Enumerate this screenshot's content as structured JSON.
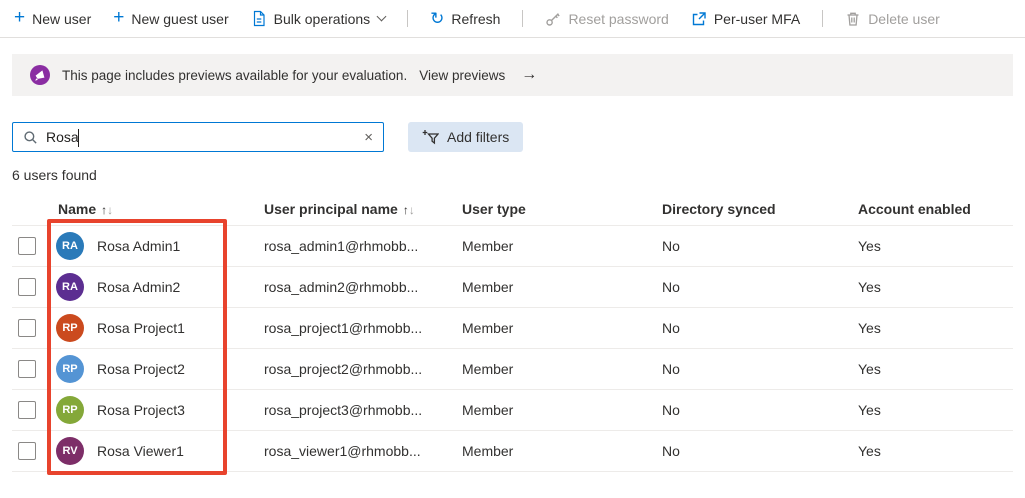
{
  "colors": {
    "accent": "#0078d4",
    "disabled_text": "#a19f9d",
    "highlight_red": "#e8432d",
    "banner_icon_purple": "#8a2da2"
  },
  "toolbar": {
    "new_user": "New user",
    "new_guest_user": "New guest user",
    "bulk_operations": "Bulk operations",
    "refresh": "Refresh",
    "reset_password": "Reset password",
    "per_user_mfa": "Per-user MFA",
    "delete_user": "Delete user"
  },
  "icons": {
    "plus": "+",
    "refresh": "↻",
    "clear": "×",
    "arrow_right": "→",
    "sort_up": "↑",
    "sort_down": "↓"
  },
  "banner": {
    "text": "This page includes previews available for your evaluation.",
    "link_label": "View previews",
    "arrow": "→"
  },
  "search": {
    "value": "Rosa"
  },
  "filters": {
    "add_filters_label": "Add filters"
  },
  "status": {
    "results_count": "6 users found"
  },
  "table": {
    "headers": {
      "name": "Name",
      "upn": "User principal name",
      "user_type": "User type",
      "directory_synced": "Directory synced",
      "account_enabled": "Account enabled"
    },
    "rows": [
      {
        "initials": "RA",
        "avatar_color": "#2a7ab9",
        "name": "Rosa Admin1",
        "upn": "rosa_admin1@rhmobb...",
        "user_type": "Member",
        "directory_synced": "No",
        "account_enabled": "Yes"
      },
      {
        "initials": "RA",
        "avatar_color": "#5c2e91",
        "name": "Rosa Admin2",
        "upn": "rosa_admin2@rhmobb...",
        "user_type": "Member",
        "directory_synced": "No",
        "account_enabled": "Yes"
      },
      {
        "initials": "RP",
        "avatar_color": "#cb4a1e",
        "name": "Rosa Project1",
        "upn": "rosa_project1@rhmobb...",
        "user_type": "Member",
        "directory_synced": "No",
        "account_enabled": "Yes"
      },
      {
        "initials": "RP",
        "avatar_color": "#5494d4",
        "name": "Rosa Project2",
        "upn": "rosa_project2@rhmobb...",
        "user_type": "Member",
        "directory_synced": "No",
        "account_enabled": "Yes"
      },
      {
        "initials": "RP",
        "avatar_color": "#84a839",
        "name": "Rosa Project3",
        "upn": "rosa_project3@rhmobb...",
        "user_type": "Member",
        "directory_synced": "No",
        "account_enabled": "Yes"
      },
      {
        "initials": "RV",
        "avatar_color": "#7d2e68",
        "name": "Rosa Viewer1",
        "upn": "rosa_viewer1@rhmobb...",
        "user_type": "Member",
        "directory_synced": "No",
        "account_enabled": "Yes"
      }
    ]
  },
  "annotation": {
    "highlight_color": "#e8432d"
  }
}
